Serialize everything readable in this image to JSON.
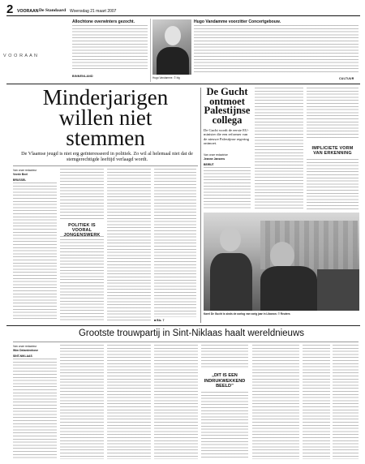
{
  "header": {
    "page_number": "2",
    "section": "VOORAAN",
    "paper": "De Standaard",
    "date": "Woensdag 21 maart 2007"
  },
  "sidebar_vertical": "V O O R A A N",
  "top_left_story": {
    "title": "Allochtone overwinters gezocht.",
    "section_label": "BINNENLAND"
  },
  "top_right_story": {
    "title": "Hugo Vandamme voorzitter Concertgebouw.",
    "photo_caption": "Hugo Vandamme. © blg",
    "section_label": "CULTUUR"
  },
  "main_story": {
    "headline_lines": [
      "Minderjarigen",
      "willen niet",
      "stemmen"
    ],
    "deck": "De Vlaamse jeugd is niet erg geïnteresseerd in politiek. Zo wil al helemaal niet dat de stemgerechtigde leeftijd verlaagd wordt.",
    "byline": "Van onze redacteur",
    "byline_name": "Veerle Beel",
    "dateline": "BRUSSEL",
    "subhead": "POLITIEK IS VOORAL JONGENSWERK",
    "end_mark": "■ Blz. 7"
  },
  "side_story": {
    "headline_lines": [
      "De Gucht",
      "ontmoet",
      "Palestijnse",
      "collega"
    ],
    "deck": "De Gucht wordt de eerste EU-minister die een reformer van de nieuwe Palestijnse regering ontmoet.",
    "byline": "Van onze redactrice",
    "byline_name": "Jeanne Jansens",
    "dateline": "BEIRUT",
    "subhead_lines": [
      "IMPLICIETE VORM",
      "VAN ERKENNING"
    ],
    "photo_caption": "Karel De Gucht is sinds de oorlog van vorig jaar in Libanon. © Reuters"
  },
  "bottom_story": {
    "headline": "Grootste trouwpartij in Sint-Niklaas haalt wereldnieuws",
    "byline": "Van onze redacteur",
    "byline_name": "Wim Delaedenhove",
    "dateline": "SINT-NIKLAAS",
    "pullquote_lines": [
      "„DIT IS EEN",
      "INDRUKWEKKEND",
      "BEELD”"
    ]
  }
}
